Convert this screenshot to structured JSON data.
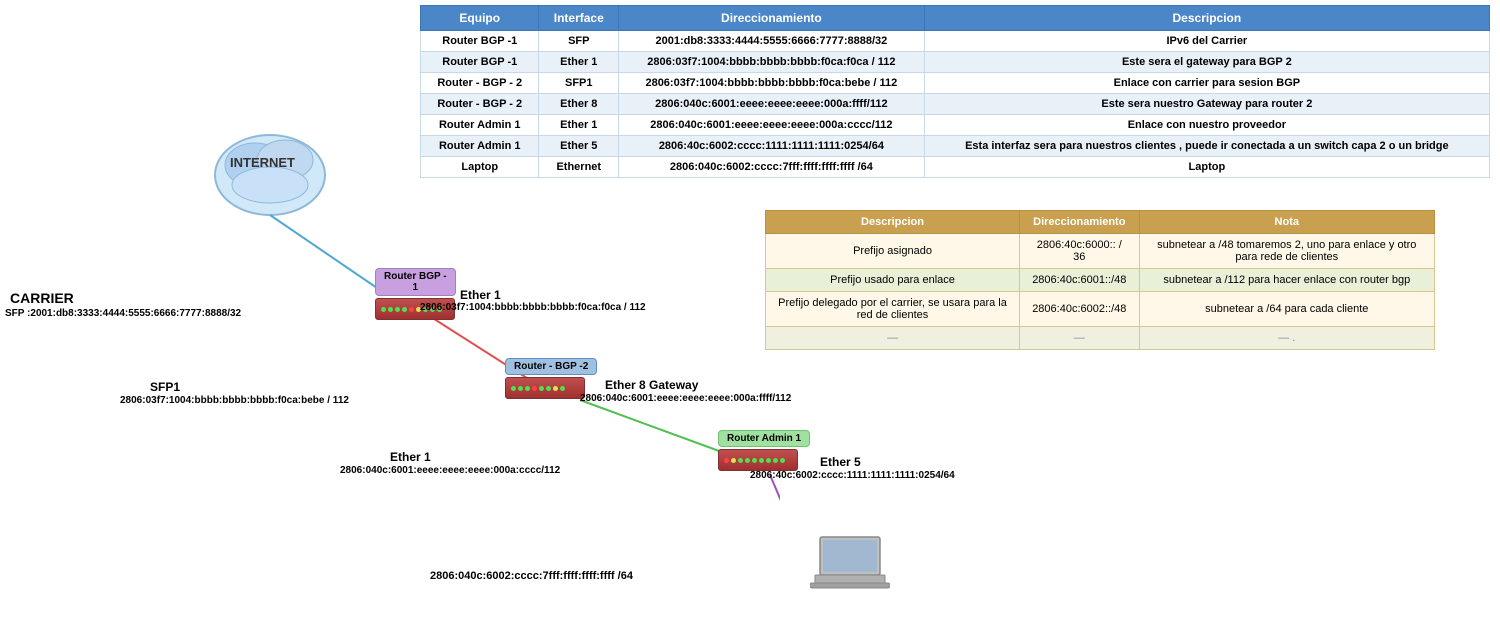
{
  "table": {
    "headers": [
      "Equipo",
      "Interface",
      "Direccionamiento",
      "Descripcion"
    ],
    "rows": [
      {
        "equipo": "Router BGP -1",
        "interface": "SFP",
        "dir": "2001:db8:3333:4444:5555:6666:7777:8888/32",
        "desc": "IPv6 del Carrier"
      },
      {
        "equipo": "Router BGP -1",
        "interface": "Ether 1",
        "dir": "2806:03f7:1004:bbbb:bbbb:bbbb:f0ca:f0ca / 112",
        "desc": "Este sera el gateway para BGP 2"
      },
      {
        "equipo": "Router - BGP - 2",
        "interface": "SFP1",
        "dir": "2806:03f7:1004:bbbb:bbbb:bbbb:f0ca:bebe / 112",
        "desc": "Enlace con carrier para sesion BGP"
      },
      {
        "equipo": "Router - BGP - 2",
        "interface": "Ether 8",
        "dir": "2806:040c:6001:eeee:eeee:eeee:000a:ffff/112",
        "desc": "Este sera nuestro Gateway para router 2"
      },
      {
        "equipo": "Router Admin 1",
        "interface": "Ether 1",
        "dir": "2806:040c:6001:eeee:eeee:eeee:000a:cccc/112",
        "desc": "Enlace con nuestro proveedor"
      },
      {
        "equipo": "Router Admin 1",
        "interface": "Ether 5",
        "dir": "2806:40c:6002:cccc:1111:1111:1111:0254/64",
        "desc": "Esta interfaz sera para nuestros clientes , puede ir conectada a un switch capa 2 o un bridge"
      },
      {
        "equipo": "Laptop",
        "interface": "Ethernet",
        "dir": "2806:040c:6002:cccc:7fff:ffff:ffff:ffff /64",
        "desc": "Laptop"
      }
    ]
  },
  "second_table": {
    "headers": [
      "Descripcion",
      "Direccionamiento",
      "Nota"
    ],
    "rows": [
      {
        "desc": "Prefijo asignado",
        "dir": "2806:40c:6000:: / 36",
        "nota": "subnetear a /48  tomaremos 2, uno para enlace y otro para rede de clientes"
      },
      {
        "desc": "Prefijo usado para enlace",
        "dir": "2806:40c:6001::/48",
        "nota": "subnetear a /112 para hacer enlace con router bgp"
      },
      {
        "desc": "Prefijo delegado por el carrier, se usara para la red de clientes",
        "dir": "2806:40c:6002::/48",
        "nota": "subnetear a /64 para cada cliente"
      },
      {
        "desc": "—",
        "dir": "—",
        "nota": "—  ."
      }
    ]
  },
  "diagram": {
    "internet_label": "INTERNET",
    "carrier_label": "CARRIER",
    "carrier_addr": "SFP :2001:db8:3333:4444:5555:6666:7777:8888/32",
    "router_bgp1_label": "Router BGP -\n1",
    "router_bgp2_label": "Router - BGP -2",
    "router_admin1_label": "Router Admin 1",
    "ether1_label": "Ether 1",
    "ether1_addr": "2806:03f7:1004:bbbb:bbbb:bbbb:f0ca:f0ca / 112",
    "sfp1_label": "SFP1",
    "sfp1_addr": "2806:03f7:1004:bbbb:bbbb:bbbb:f0ca:bebe / 112",
    "ether8_label": "Ether 8 Gateway",
    "ether8_addr": "2806:040c:6001:eeee:eeee:eeee:000a:ffff/112",
    "ether1_admin_label": "Ether 1",
    "ether1_admin_addr": "2806:040c:6001:eeee:eeee:eeee:000a:cccc/112",
    "ether5_label": "Ether 5",
    "ether5_addr": "2806:40c:6002:cccc:1111:1111:1111:0254/64",
    "laptop_addr": "2806:040c:6002:cccc:7fff:ffff:ffff:ffff /64"
  }
}
